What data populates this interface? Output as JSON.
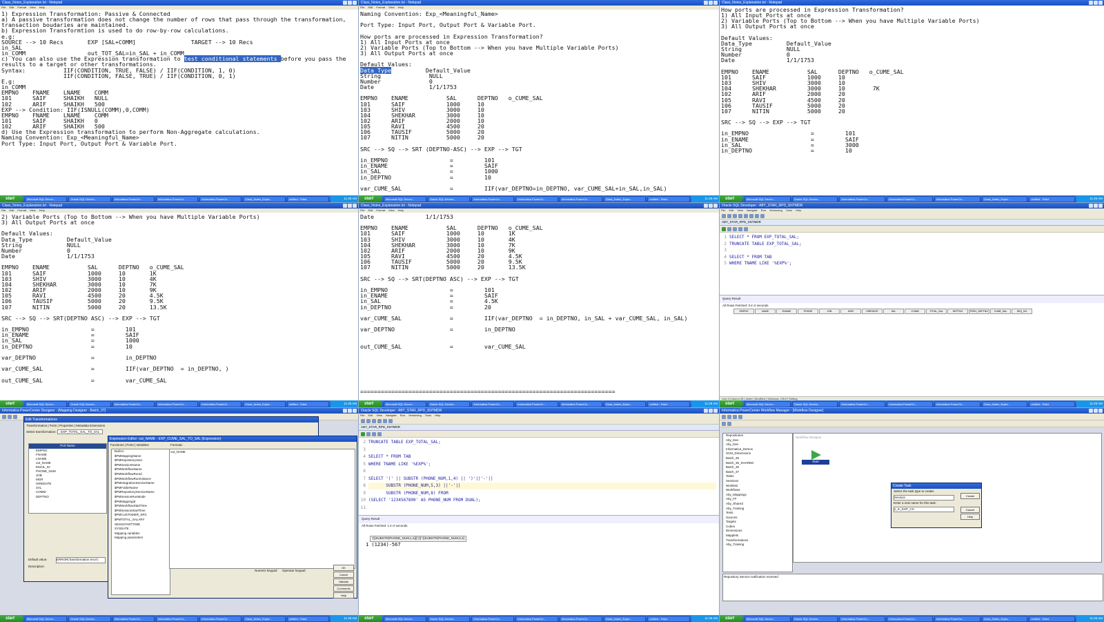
{
  "panels": {
    "p1": {
      "title": "Class_Notes_Explanation.txt - Notepad",
      "menu": [
        "File",
        "Edit",
        "Format",
        "View",
        "Help"
      ],
      "lines": {
        "l1": "1) Expression Transformation: Passive & Connected",
        "l2": "",
        "l3": "a) A passive transformation does not change the number of rows that pass through the transformation,",
        "l4": "transaction boudaries are maintained.",
        "l5": "",
        "l6": "b) Expression Transformtion is used to do row-by-row calculations.",
        "l7": "e.g:",
        "l8": "SOURCE --> 10 Recs       EXP [SAL+COMM]                TARGET --> 10 Recs",
        "l9": "in_SAL",
        "l10": "in_COMM                  out_TOT_SAL=in_SAL + in_COMM",
        "l11": "",
        "l12a": "c) You can also use the Expression transformation to ",
        "l12b": "test conditional statements ",
        "l12c": "before you pass the",
        "l13": "results to a target or other transformations.",
        "l14": "Syntax:           IIF(CONDITION, TRUE, FALSE) / IIF(CONDITION, 1, 0)",
        "l15": "                  IIF(CONDITION, FALSE, TRUE) / IIF(CONDITION, 0, 1)",
        "l16": "",
        "l17": "E.g:",
        "l18": "in_COMM",
        "l19": "",
        "l20": "EMPNO    FNAME    LNAME    COMM",
        "l21": "101      SAIF     SHAIKH   NULL",
        "l22": "102      ARIF     SHAIKH   500",
        "l23": "",
        "l24": "EXP --> Condition: IIF(ISNULL(COMM),0,COMM)",
        "l25": "EMPNO    FNAME    LNAME    COMM",
        "l26": "101      SAIF     SHAIKH   0",
        "l27": "102      ARIF     SHAIKH   500",
        "l28": "",
        "l29": "d) Use the Expression transformation to perform Non-Aggregate calculations.",
        "l30": "",
        "l31": "Naming Convention: Exp_<Meaningful_Name>",
        "l32": "",
        "l33": "Port Type: Input Port, Output Port & Variable Port."
      }
    },
    "p2": {
      "title": "Class_Notes_Explanation.txt - Notepad",
      "before": "Naming Convention: Exp_<Meaningful_Name>\n\nPort Type: Input Port, Output Port & Variable Port.\n\nHow ports are processed in Expression Transformation?\n1) All Input Ports at once\n2) Variable Ports (Top to Bottom --> When you have Multiple Variable Ports)\n3) All Output Ports at once\n\nDefault Values:",
      "hl": "Data_Type",
      "hl_rest": "          Default_Value",
      "after": "String              NULL\nNumber              0\nDate                1/1/1753\n\nEMPNO    ENAME           SAL      DEPTNO   o_CUME_SAL\n101      SAIF            1000     10\n103      SHIV            3000     10\n104      SHEKHAR         3000     10\n102      ARIF            2000     10\n105      RAVI            4500     20\n106      TAUSIF          5000     20\n107      NITIN           5000     20\n\nSRC --> SQ --> SRT (DEPTNO-ASC) --> EXP --> TGT\n\nin_EMPNO                  =         101\nin_ENAME                  =         SAIF\nin_SAL                    =         1000\nin_DEPTNO                 =         10\n\nvar_CUME_SAL              =         IIF(var_DEPTNO=in_DEPTNO, var_CUME_SAL+in_SAL,in_SAL)"
    },
    "p3": {
      "title": "Class_Notes_Explanation.txt - Notepad",
      "text": "How ports are processed in Expression Transformation?\n1) All Input Ports at once\n2) Variable Ports (Top to Bottom --> When you have Multiple Variable Ports)\n3) All Output Ports at once\n\nDefault Values:\nData_Type          Default_Value\nString             NULL\nNumber             0\nDate               1/1/1753\n\nEMPNO    ENAME           SAL      DEPTNO   o_CUME_SAL\n101      SAIF            1000     10\n103      SHIV            3000     10\n104      SHEKHAR         3000     10        7K\n102      ARIF            2000     20\n105      RAVI            4500     20\n106      TAUSIF          5000     20\n107      NITIN           5000     20\n\nSRC --> SQ --> EXP --> TGT\n\nin_EMPNO                  =         101\nin_ENAME                  =         SAIF\nin_SAL                    =         3000\nin_DEPTNO                 =         10"
    },
    "p4": {
      "title": "Class_Notes_Explanation.txt - Notepad",
      "text": "2) Variable Ports (Top to Bottom --> When you have Multiple Variable Ports)\n3) All Output Ports at once\n\nDefault Values:\nData_Type          Default_Value\nString             NULL\nNumber             0\nDate               1/1/1753\n\nEMPNO    ENAME           SAL      DEPTNO   o_CUME_SAL\n101      SAIF            1000     10       1K\n103      SHIV            3000     10       4K\n104      SHEKHAR         3000     10       7K\n102      ARIF            2000     10       9K\n105      RAVI            4500     20       4.5K\n106      TAUSIF          5000     20       9.5K\n107      NITIN           5000     20       13.5K\n\nSRC --> SQ --> SRT(DEPTNO ASC) --> EXP --> TGT\n\nin_EMPNO                  =         101\nin_ENAME                  =         SAIF\nin_SAL                    =         1000\nin_DEPTNO                 =         10\n\nvar_DEPTNO                =         in_DEPTNO\n\nvar_CUME_SAL              =         IIF(var_DEPTNO  = in_DEPTNO, )\n\nout_CUME_SAL              =         var_CUME_SAL"
    },
    "p5": {
      "title": "Class_Notes_Explanation.txt - Notepad",
      "text": "Date               1/1/1753\n\nEMPNO    ENAME           SAL      DEPTNO   o_CUME_SAL\n101      SAIF            1000     10       1K\n103      SHIV            3000     10       4K\n104      SHEKHAR         3000     10       7K\n102      ARIF            2000     10       9K\n105      RAVI            4500     20       4.5K\n106      TAUSIF          5000     20       9.5K\n107      NITIN           5000     20       13.5K\n\nSRC --> SQ --> SRT(DEPTNO ASC) --> EXP --> TGT\n\nin_EMPNO                  =         101\nin_ENAME                  =         SAIF\nin_SAL                    =         4.5K\nin_DEPTNO                 =         20\n\nvar_CUME_SAL              =         IIF(var_DEPTNO  = in_DEPTNO, in_SAL + var_CUME_SAL, in_SAL)\n\nvar_DEPTNO                =         in_DEPTNO\n\n\nout_CUME_SAL              =         var_CUME_SAL\n\n\n\n\n\n\n\n=========================================================================="
    },
    "p6": {
      "title": "Oracle SQL Developer : ABY_STAR_RPD_SNTMDR",
      "tab": "ABY_STAR_RPD_SNTMDR",
      "sql": [
        "SELECT * FROM EXP_TOTAL_SAL;",
        "TRUNCATE TABLE EXP_TOTAL_SAL;",
        "",
        "SELECT * FROM TAB",
        "WHERE TNAME LIKE '%EXP%';"
      ],
      "result_tab": "Query Result",
      "result_info": "All Rows Fetched: 0 in 0 seconds",
      "columns": [
        "EMPNO",
        "NAME",
        "ENAME",
        "PHONE",
        "JOB",
        "MGR",
        "HIREDATE",
        "SAL",
        "COMM",
        "TOTAL_SAL",
        "DEPTNO",
        "PREV_DEPTNO",
        "CUME_SAL",
        "SEQ_NO"
      ],
      "status": "Line 4 Column 28 | Insert | Modified | Windows: CR/LF Editing"
    },
    "p7": {
      "title": "Informatica PowerCenter Designer - [Mapping Designer - Batch_37]",
      "edit_title": "Edit Transformations",
      "edit_tabs": [
        "Transformation",
        "Ports",
        "Properties",
        "Metadata Extensions"
      ],
      "select_label": "Select transformation:",
      "select_value": "EXP_TOTAL_SAL_TO_SAL",
      "port_header": "Port Name",
      "ports": [
        "EMPNO",
        "FNAME",
        "LNAME",
        "out_NAME",
        "EMAIL_ID",
        "PHONE_NUM",
        "JOB",
        "MGR",
        "HIREDATE",
        "SAL",
        "COMM",
        "DEPTNO"
      ],
      "expr_title": "Expression Editor: out_NAME - EXP_CUME_SAL_TO_SAL (Expression)",
      "expr_tabs": [
        "Functions",
        "Ports",
        "Variables"
      ],
      "expr_tree": [
        "Built-in",
        "$PMMappingName",
        "$PMRepositoryUser",
        "$PMSessionName",
        "$PMWorkflowName",
        "$PMWorkflowRunId",
        "$PMWorkflowRunInstance",
        "$PMIntegrationServiceName",
        "$PMFolderName",
        "$PMRepositoryServiceName",
        "$PMSessionRunMode",
        "$PMMappingId",
        "$PMWorkflowStartTime",
        "$PMSessionStartTime",
        "$PMCUSTOMER_SRC",
        "$PMTOTAL_SALARY",
        "SESSSTARTTIME",
        "SYSDATE",
        "Mapping variables",
        "Mapping parameters"
      ],
      "formula_label": "Formula:",
      "formula_value": "out_NAME",
      "default_label": "Default value:",
      "default_value": "ERROR('transformation error')",
      "desc_label": "Description:",
      "numeric_label": "Numeric keypad",
      "operator_label": "Operator keypad",
      "buttons": [
        "OK",
        "Cancel",
        "Validate",
        "Comments",
        "Help"
      ]
    },
    "p8": {
      "title": "Oracle SQL Developer : ABY_STAR_RPD_SNTMDR",
      "tab": "ABY_STAR_RPD_SNTMDR",
      "line_nums": [
        "2",
        "3",
        "4",
        "5",
        "6",
        "7",
        "8",
        "9",
        "10",
        "11"
      ],
      "sql": [
        "TRUNCATE TABLE EXP_TOTAL_SAL;",
        "",
        "SELECT * FROM TAB",
        "WHERE TNAME LIKE '%EXP%';",
        "",
        "SELECT '(' || SUBSTR (PHONE_NUM,1,4) || ')'||'-'||",
        "       SUBSTR (PHONE_NUM,5,3) ||'-'||",
        "       SUBSTR (PHONE_NUM,8) FROM",
        "(SELECT '1234567890' AS PHONE_NUM FROM DUAL);",
        ""
      ],
      "result_tab": "Query Result",
      "result_info": "All Rows Fetched: 1 in 0 seconds",
      "result_col": "'('||SUBSTR(PHONE_NUM,1,4)||')'||'-'||SUBSTR(PHONE_NUM,5,3)",
      "result_row": "1 (1234)-567"
    },
    "p9": {
      "title": "Informatica PowerCenter Workflow Manager - [Workflow Designer]",
      "tree": [
        "Repositories",
        "Aby_Dev",
        "Aby_Dev",
        "Informatica_Demos",
        "SCM_Dimensions",
        "Batch_36",
        "Batch_36_SHARED",
        "Batch_36",
        "Batch_37",
        "Tasks",
        "Sessions",
        "Worklets",
        "Workflows",
        "Aby_Mappings",
        "Aby_FF",
        "Aby_Shared",
        "Aby_Training",
        "Tests",
        "Sources",
        "Targets",
        "Cubes",
        "Dimensions",
        "Mapplets",
        "Transformations",
        "Aby_Training"
      ],
      "canvas_label": "Workflow Designer",
      "start_label": "Start",
      "dialog_title": "Create Task",
      "dialog_l1": "Select the task type to create:",
      "dialog_sel": "Session",
      "dialog_l2": "Enter a new name for this task:",
      "dialog_val": "s_m_EXP_CS",
      "dialog_btns": [
        "Create",
        "Cancel",
        "Help"
      ],
      "output": "Repository Service notification received"
    }
  },
  "taskbar": {
    "start": "start",
    "items": [
      "Microsoft SQL Server...",
      "Oracle SQL Develo...",
      "Informatica PowerCe...",
      "Informatica PowerCe...",
      "Informatica PowerCe...",
      "Class_Notes_Expla...",
      "untitled - Paint"
    ],
    "clock": "11:28 AM"
  },
  "colors": {
    "titlebar": "#1d4fbd",
    "taskbar": "#2456c8",
    "highlight": "#3166c4",
    "start": "#3fae3f"
  }
}
